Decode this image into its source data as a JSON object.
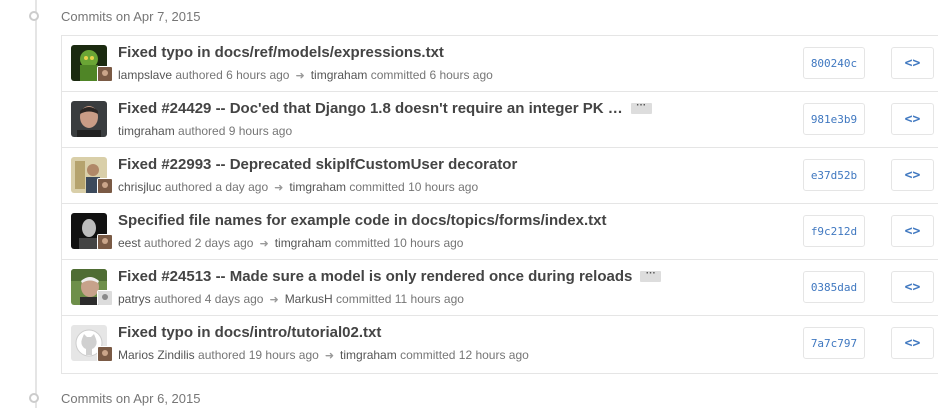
{
  "groups": [
    {
      "title": "Commits on Apr 7, 2015"
    },
    {
      "title": "Commits on Apr 6, 2015"
    }
  ],
  "commits": [
    {
      "message": "Fixed typo in docs/ref/models/expressions.txt",
      "has_ellipsis": false,
      "author": "lampslave",
      "authored_label": "authored",
      "authored_time": "6 hours ago",
      "committer": "timgraham",
      "committed_label": "committed",
      "committed_time": "6 hours ago",
      "sha": "800240c",
      "browse_icon": "<>"
    },
    {
      "message": "Fixed #24429 -- Doc'ed that Django 1.8 doesn't require an integer PK …",
      "has_ellipsis": true,
      "ellipsis": "···",
      "author": "timgraham",
      "authored_label": "authored",
      "authored_time": "9 hours ago",
      "sha": "981e3b9",
      "browse_icon": "<>"
    },
    {
      "message": "Fixed #22993 -- Deprecated skipIfCustomUser decorator",
      "has_ellipsis": false,
      "author": "chrisjluc",
      "authored_label": "authored",
      "authored_time": "a day ago",
      "committer": "timgraham",
      "committed_label": "committed",
      "committed_time": "10 hours ago",
      "sha": "e37d52b",
      "browse_icon": "<>"
    },
    {
      "message": "Specified file names for example code in docs/topics/forms/index.txt",
      "has_ellipsis": false,
      "author": "eest",
      "authored_label": "authored",
      "authored_time": "2 days ago",
      "committer": "timgraham",
      "committed_label": "committed",
      "committed_time": "10 hours ago",
      "sha": "f9c212d",
      "browse_icon": "<>"
    },
    {
      "message": "Fixed #24513 -- Made sure a model is only rendered once during reloads",
      "has_ellipsis": true,
      "ellipsis": "···",
      "author": "patrys",
      "authored_label": "authored",
      "authored_time": "4 days ago",
      "committer": "MarkusH",
      "committed_label": "committed",
      "committed_time": "11 hours ago",
      "sha": "0385dad",
      "browse_icon": "<>"
    },
    {
      "message": "Fixed typo in docs/intro/tutorial02.txt",
      "has_ellipsis": false,
      "author": "Marios Zindilis",
      "authored_label": "authored",
      "authored_time": "19 hours ago",
      "committer": "timgraham",
      "committed_label": "committed",
      "committed_time": "12 hours ago",
      "sha": "7a7c797",
      "browse_icon": "<>"
    }
  ]
}
